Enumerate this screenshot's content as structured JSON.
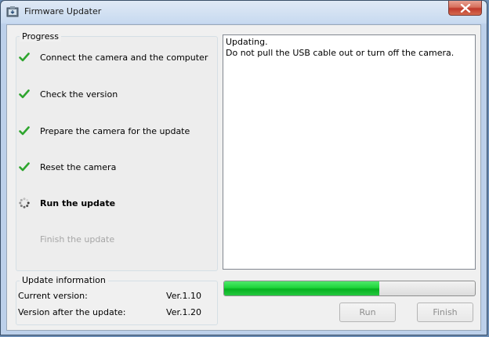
{
  "window": {
    "title": "Firmware Updater"
  },
  "progress": {
    "legend": "Progress",
    "steps": [
      {
        "label": "Connect the camera and the computer",
        "state": "done"
      },
      {
        "label": "Check the version",
        "state": "done"
      },
      {
        "label": "Prepare the camera for the update",
        "state": "done"
      },
      {
        "label": "Reset the camera",
        "state": "done"
      },
      {
        "label": "Run the update",
        "state": "active"
      },
      {
        "label": "Finish the update",
        "state": "pending"
      }
    ]
  },
  "log": {
    "lines": [
      "Updating.",
      "Do not pull the USB cable out or turn off the camera."
    ]
  },
  "update_info": {
    "legend": "Update information",
    "current_label": "Current version:",
    "current_value": "Ver.1.10",
    "after_label": "Version after the update:",
    "after_value": "Ver.1.20"
  },
  "progress_bar": {
    "fraction": 0.62,
    "color": "#1fd43b"
  },
  "buttons": {
    "run": "Run",
    "finish": "Finish"
  },
  "colors": {
    "check": "#2ea52e",
    "pending_text": "#a6a6a6"
  }
}
